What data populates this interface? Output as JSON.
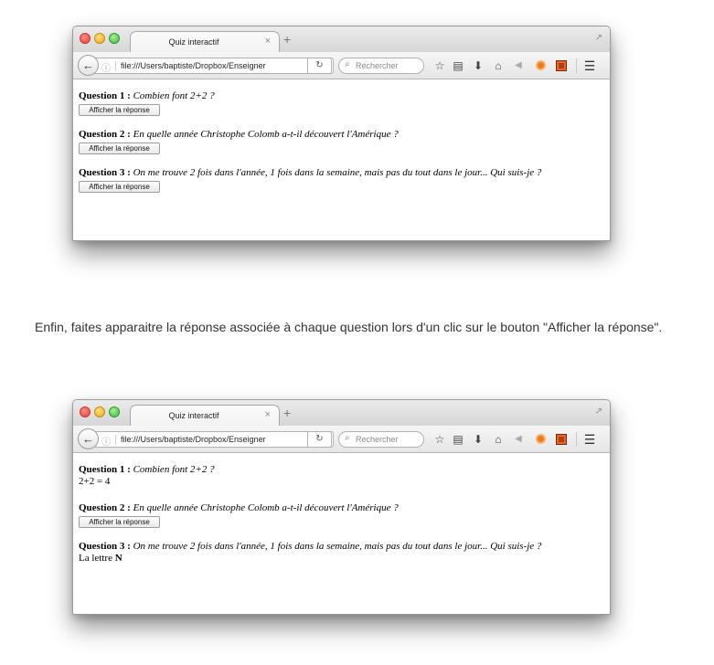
{
  "browser": {
    "tab_title": "Quiz interactif",
    "tab_close": "×",
    "new_tab": "+",
    "url": "file:///Users/baptiste/Dropbox/Enseigner",
    "search_placeholder": "Rechercher"
  },
  "questions": [
    {
      "label": "Question 1 :",
      "text": "Combien font 2+2 ?",
      "answer": "2+2 = 4"
    },
    {
      "label": "Question 2 :",
      "text": "En quelle année Christophe Colomb a-t-il découvert l'Amérique ?",
      "answer": ""
    },
    {
      "label": "Question 3 :",
      "text": "On me trouve 2 fois dans l'année, 1 fois dans la semaine, mais pas du tout dans le jour... Qui suis-je ?",
      "answer_prefix": "La lettre",
      "answer_letter": "N"
    }
  ],
  "button_label": "Afficher la réponse",
  "paragraph": "Enfin, faites apparaitre la réponse associée à chaque question lors d'un clic sur le bouton \"Afficher la réponse\"."
}
